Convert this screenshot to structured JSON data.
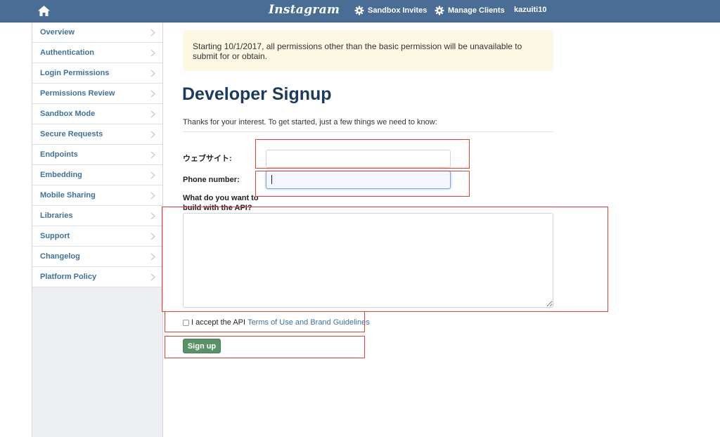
{
  "topbar": {
    "brand": "Instagram",
    "links": [
      {
        "label": "Sandbox Invites",
        "icon": "gear-icon"
      },
      {
        "label": "Manage Clients",
        "icon": "gear-icon"
      }
    ],
    "user": "kazuiti10"
  },
  "sidebar": {
    "items": [
      {
        "label": "Overview"
      },
      {
        "label": "Authentication"
      },
      {
        "label": "Login Permissions"
      },
      {
        "label": "Permissions Review"
      },
      {
        "label": "Sandbox Mode"
      },
      {
        "label": "Secure Requests"
      },
      {
        "label": "Endpoints"
      },
      {
        "label": "Embedding"
      },
      {
        "label": "Mobile Sharing"
      },
      {
        "label": "Libraries"
      },
      {
        "label": "Support"
      },
      {
        "label": "Changelog"
      },
      {
        "label": "Platform Policy"
      }
    ]
  },
  "notice": "Starting 10/1/2017, all permissions other than the basic permission will be unavailable to submit for or obtain.",
  "page": {
    "title": "Developer Signup",
    "lead": "Thanks for your interest. To get started, just a few things we need to know:"
  },
  "form": {
    "website_label": "ウェブサイト:",
    "website_value": "",
    "phone_label": "Phone number:",
    "phone_value": "",
    "purpose_label": "What do you want to build with the API?",
    "purpose_value": "",
    "accept_text": "I accept the API",
    "accept_link": "Terms of Use and Brand Guidelines",
    "submit": "Sign up"
  },
  "colors": {
    "topbar": "#4a6d96",
    "link": "#3f729b",
    "notice_bg": "#fcf8e3",
    "button": "#5a9267",
    "highlight": "#e2442f"
  }
}
